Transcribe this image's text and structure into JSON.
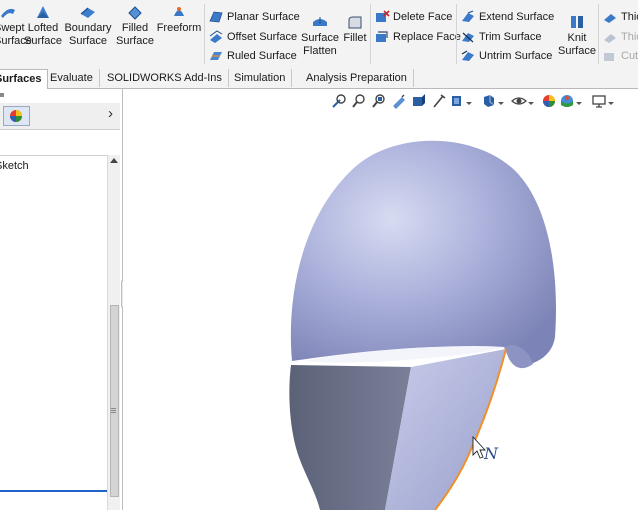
{
  "ribbon": {
    "big_buttons": [
      {
        "line1": "Swept",
        "line2": "Surface",
        "icon": "swept-surface-icon"
      },
      {
        "line1": "Lofted",
        "line2": "Surface",
        "icon": "lofted-surface-icon"
      },
      {
        "line1": "Boundary",
        "line2": "Surface",
        "icon": "boundary-surface-icon"
      },
      {
        "line1": "Filled",
        "line2": "Surface",
        "icon": "filled-surface-icon"
      },
      {
        "line1": "Freeform",
        "line2": "",
        "icon": "freeform-icon"
      },
      {
        "line1": "Surface",
        "line2": "Flatten",
        "icon": "surface-flatten-icon"
      },
      {
        "line1": "Fillet",
        "line2": "",
        "icon": "fillet-icon"
      },
      {
        "line1": "Knit",
        "line2": "Surface",
        "icon": "knit-surface-icon"
      }
    ],
    "small_buttons": {
      "planar": "Planar Surface",
      "offset": "Offset Surface",
      "ruled": "Ruled Surface",
      "delete_face": "Delete Face",
      "replace_face": "Replace Face",
      "extend": "Extend Surface",
      "trim": "Trim Surface",
      "untrim": "Untrim Surface",
      "thicken": "Thic",
      "thicken_cut_1": "Thic",
      "cut": "Cut"
    }
  },
  "tabs": [
    {
      "label": "Surfaces",
      "active": true
    },
    {
      "label": "Evaluate",
      "active": false
    },
    {
      "label": "SOLIDWORKS Add-Ins",
      "active": false
    },
    {
      "label": "Simulation",
      "active": false
    },
    {
      "label": "Analysis Preparation",
      "active": false
    }
  ],
  "left_panel": {
    "tree_item": "Sketch",
    "collapse_arrow": "›"
  },
  "viewport": {
    "cursor_label": "N",
    "model_color": "#a9b0d8",
    "edge_color": "#f0902a"
  }
}
